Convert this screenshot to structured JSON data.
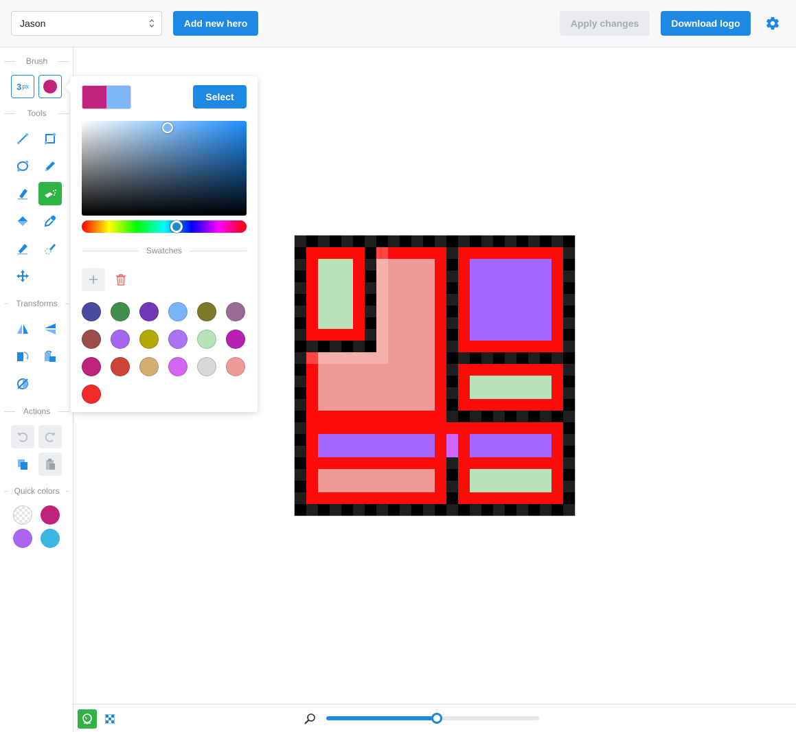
{
  "header": {
    "hero_select_value": "Jason",
    "add_hero_label": "Add new hero",
    "apply_label": "Apply changes",
    "download_label": "Download logo"
  },
  "sidebar": {
    "brush_title": "Brush",
    "brush_size_value": "3",
    "brush_size_unit": "px",
    "brush_color": "#c0227e",
    "tools_title": "Tools",
    "tools": [
      "line-tool-icon",
      "rectangle-tool-icon",
      "ellipse-tool-icon",
      "pencil-tool-icon",
      "eraser-tool-icon",
      "spray-tool-icon",
      "fill-bucket-icon",
      "eyedropper-icon",
      "marker-icon",
      "gradient-icon",
      "move-icon"
    ],
    "active_tool": "spray-tool-icon",
    "transforms_title": "Transforms",
    "actions_title": "Actions",
    "quick_colors_title": "Quick colors",
    "quick_colors": [
      "transparent",
      "#c0227e",
      "#aa66f0",
      "#3cb7e4"
    ]
  },
  "picker": {
    "primary_color": "#c0227e",
    "secondary_color": "#7db7fa",
    "select_label": "Select",
    "swatches_title": "Swatches",
    "hue_position": 0.57,
    "swatches": [
      "#4a4a9e",
      "#3f8e4a",
      "#7236b8",
      "#78b4f8",
      "#7d7a28",
      "#9a6a92",
      "#9b4e48",
      "#a466ef",
      "#b3a70a",
      "#ac72f2",
      "#b8e3b8",
      "#b81fb3",
      "#c0227e",
      "#cc4436",
      "#d4ad73",
      "#d466f4",
      "#d8d8d8",
      "#ef9a96",
      "#f22a2a"
    ]
  },
  "bottombar": {
    "zoom_fraction": 0.52
  },
  "colors": {
    "accent": "#1e88e5",
    "active_tool": "#2fb344",
    "logo_red": "#ff0a0a",
    "logo_green": "#b8e3b8",
    "logo_purple": "#a466ff",
    "logo_salmon": "#ef9a96",
    "logo_magenta": "#cc66ff"
  }
}
